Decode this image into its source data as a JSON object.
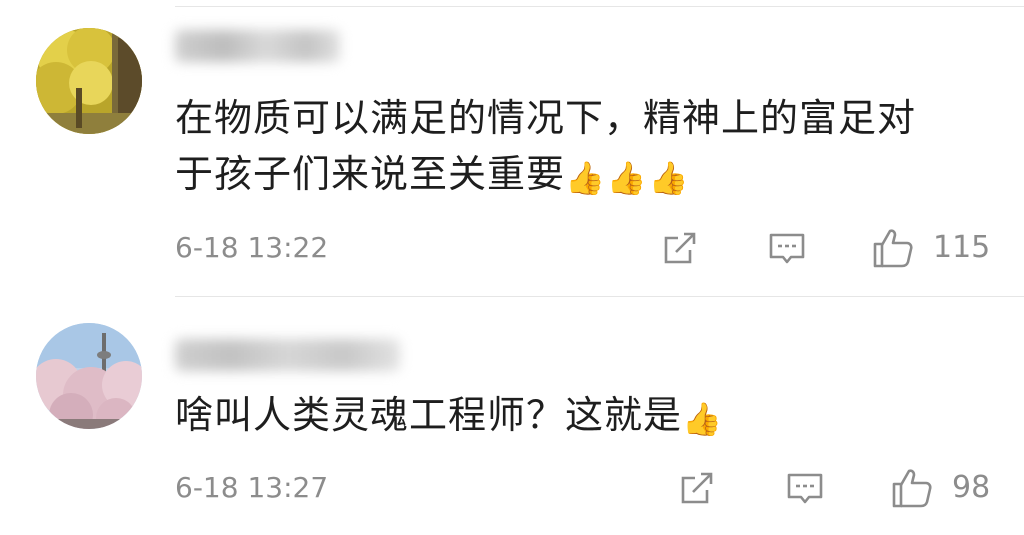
{
  "comments": [
    {
      "username": "",
      "text_line1": "在物质可以满足的情况下，精神上的富足对",
      "text_line2": "于孩子们来说至关重要",
      "emoji": "👍👍👍",
      "time": "6-18 13:22",
      "likes": "115",
      "avatar_icon": "ginkgo-tree-photo"
    },
    {
      "username": "",
      "text_line1": "啥叫人类灵魂工程师？这就是",
      "emoji": "👍",
      "time": "6-18 13:27",
      "likes": "98",
      "avatar_icon": "cherry-blossom-tower-photo"
    }
  ],
  "icons": {
    "share": "share-icon",
    "reply": "comment-icon",
    "like": "thumbs-up-icon"
  }
}
